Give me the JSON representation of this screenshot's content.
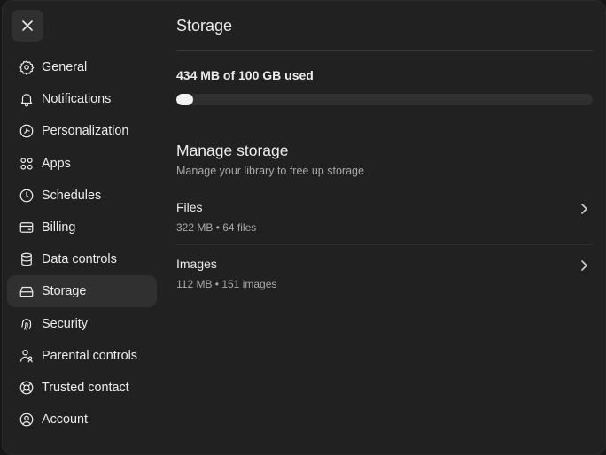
{
  "sidebar": {
    "items": [
      {
        "label": "General",
        "icon": "gear-icon"
      },
      {
        "label": "Notifications",
        "icon": "bell-icon"
      },
      {
        "label": "Personalization",
        "icon": "personalization-icon"
      },
      {
        "label": "Apps",
        "icon": "apps-grid-icon"
      },
      {
        "label": "Schedules",
        "icon": "clock-icon"
      },
      {
        "label": "Billing",
        "icon": "credit-card-icon"
      },
      {
        "label": "Data controls",
        "icon": "database-icon"
      },
      {
        "label": "Storage",
        "icon": "storage-drive-icon",
        "active": true
      },
      {
        "label": "Security",
        "icon": "fingerprint-icon"
      },
      {
        "label": "Parental controls",
        "icon": "parental-controls-icon"
      },
      {
        "label": "Trusted contact",
        "icon": "lifebuoy-icon"
      },
      {
        "label": "Account",
        "icon": "user-circle-icon"
      }
    ]
  },
  "main": {
    "title": "Storage",
    "usage": {
      "text": "434 MB of 100 GB used",
      "used_fraction": 0.00434
    },
    "manage": {
      "title": "Manage storage",
      "subtitle": "Manage your library to free up storage",
      "rows": [
        {
          "title": "Files",
          "meta": "322 MB • 64 files"
        },
        {
          "title": "Images",
          "meta": "112 MB • 151 images"
        }
      ]
    }
  },
  "colors": {
    "background": "#212121",
    "active_item": "#303030",
    "progress_fill": "#f2f2f2",
    "progress_track": "#303030"
  }
}
